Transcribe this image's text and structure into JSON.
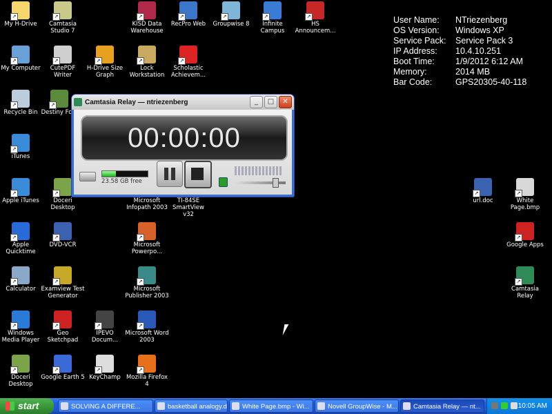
{
  "desktop_icons": [
    {
      "label": "My H-Drive",
      "color": "#f5d76e"
    },
    {
      "label": "Camtasia Studio 7",
      "color": "#c9c98a"
    },
    {
      "label": "KISD Data Warehouse",
      "color": "#b22a4a"
    },
    {
      "label": "RecPro Web",
      "color": "#3c76c9"
    },
    {
      "label": "Groupwise 8",
      "color": "#7fb6d8"
    },
    {
      "label": "Infinite Campus",
      "color": "#3a7bd5"
    },
    {
      "label": "HS Announcem...",
      "color": "#c62828"
    },
    {
      "label": "My Computer",
      "color": "#6aa0d8"
    },
    {
      "label": "CutePDF Writer",
      "color": "#cfcfcf"
    },
    {
      "label": "H-Drive Size Graph",
      "color": "#e8a020"
    },
    {
      "label": "Lock Workstation",
      "color": "#c9a860"
    },
    {
      "label": "Scholastic Achievem...",
      "color": "#d22"
    },
    {
      "label": "Recycle Bin",
      "color": "#bcd"
    },
    {
      "label": "Destiny Fo...",
      "color": "#5a8a3a"
    },
    {
      "label": "iTunes",
      "color": "#3a8bd8"
    },
    {
      "label": "Apple iTunes",
      "color": "#3a8bd8"
    },
    {
      "label": "Doceri Desktop",
      "color": "#7aa34a"
    },
    {
      "label": "Microsoft Infopath 2003",
      "color": "#7a5ab8"
    },
    {
      "label": "TI-84SE SmartView v32",
      "color": "#555"
    },
    {
      "label": "url.doc",
      "color": "#3a62b0"
    },
    {
      "label": "White Page.bmp",
      "color": "#d8d8d8"
    },
    {
      "label": "Apple Quicktime",
      "color": "#2a6ad8"
    },
    {
      "label": "DVD-VCR",
      "color": "#3a62b0"
    },
    {
      "label": "Microsoft Powerpo...",
      "color": "#d8602a"
    },
    {
      "label": "Google Apps",
      "color": "#c22"
    },
    {
      "label": "Calculator",
      "color": "#8aa8c8"
    },
    {
      "label": "Examview Test Generator",
      "color": "#c8a828"
    },
    {
      "label": "Microsoft Publisher 2003",
      "color": "#3a8a8a"
    },
    {
      "label": "Camtasia Relay",
      "color": "#2e8b57"
    },
    {
      "label": "Windows Media Player",
      "color": "#2a7ad8"
    },
    {
      "label": "Geo Sketchpad",
      "color": "#c22"
    },
    {
      "label": "IPEVO Docum...",
      "color": "#444"
    },
    {
      "label": "Microsoft Word 2003",
      "color": "#2a5ab8"
    },
    {
      "label": "Doceri Desktop",
      "color": "#7aa34a"
    },
    {
      "label": "Google Earth 5",
      "color": "#3a6ad8"
    },
    {
      "label": "KeyChamp",
      "color": "#ddd"
    },
    {
      "label": "Mozilla Firefox 4",
      "color": "#e8701a"
    }
  ],
  "system_info": [
    {
      "key": "User Name:",
      "value": "NTriezenberg"
    },
    {
      "key": "OS Version:",
      "value": "Windows XP"
    },
    {
      "key": "Service Pack:",
      "value": "Service Pack 3"
    },
    {
      "key": "IP Address:",
      "value": "10.4.10.251"
    },
    {
      "key": "Boot Time:",
      "value": "1/9/2012 6:12 AM"
    },
    {
      "key": "Memory:",
      "value": "2014 MB"
    },
    {
      "key": "Bar Code:",
      "value": "GPS20305-40-118"
    }
  ],
  "camtasia": {
    "title": "Camtasia Relay — ntriezenberg",
    "timer": "00:00:00",
    "disk_free": "23.58 GB free",
    "disk_fill": 0.3,
    "volume_level": 0.8,
    "min": "_",
    "max": "□",
    "close": "✕"
  },
  "taskbar": {
    "start_label": "start",
    "tasks": [
      {
        "label": "SOLVING A DIFFERE...",
        "active": false
      },
      {
        "label": "basketball analogy.d...",
        "active": false
      },
      {
        "label": "White Page.bmp - Wi...",
        "active": false
      },
      {
        "label": "Novell GroupWise - M...",
        "active": false
      },
      {
        "label": "Camtasia Relay — nt...",
        "active": true
      }
    ],
    "clock": "10:05 AM"
  }
}
